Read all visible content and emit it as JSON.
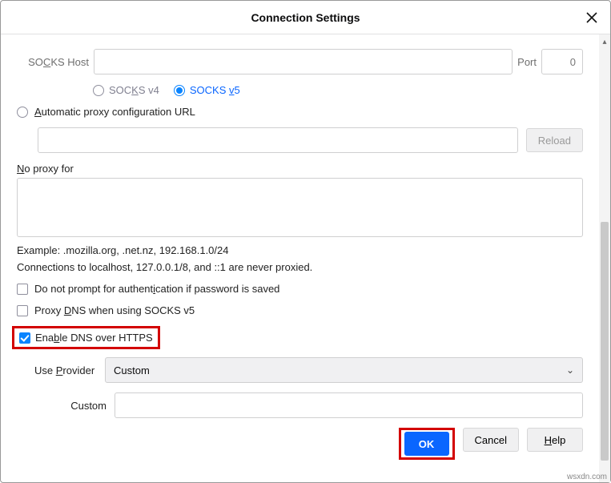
{
  "title": "Connection Settings",
  "socks": {
    "host_label": "SOCKS Host",
    "host_value": "",
    "port_label": "Port",
    "port_value": "0",
    "v4_label": "SOCKS v4",
    "v5_label": "SOCKS v5"
  },
  "auto_url": {
    "label": "Automatic proxy configuration URL",
    "value": "",
    "reload_label": "Reload"
  },
  "no_proxy": {
    "label": "No proxy for",
    "value": "",
    "example": "Example: .mozilla.org, .net.nz, 192.168.1.0/24",
    "note": "Connections to localhost, 127.0.0.1/8, and ::1 are never proxied."
  },
  "checks": {
    "no_prompt": "Do not prompt for authentication if password is saved",
    "proxy_dns": "Proxy DNS when using SOCKS v5",
    "enable_doh": "Enable DNS over HTTPS"
  },
  "provider": {
    "label": "Use Provider",
    "value": "Custom"
  },
  "custom": {
    "label": "Custom",
    "value": ""
  },
  "buttons": {
    "ok": "OK",
    "cancel": "Cancel",
    "help": "Help"
  },
  "watermark": "wsxdn.com"
}
